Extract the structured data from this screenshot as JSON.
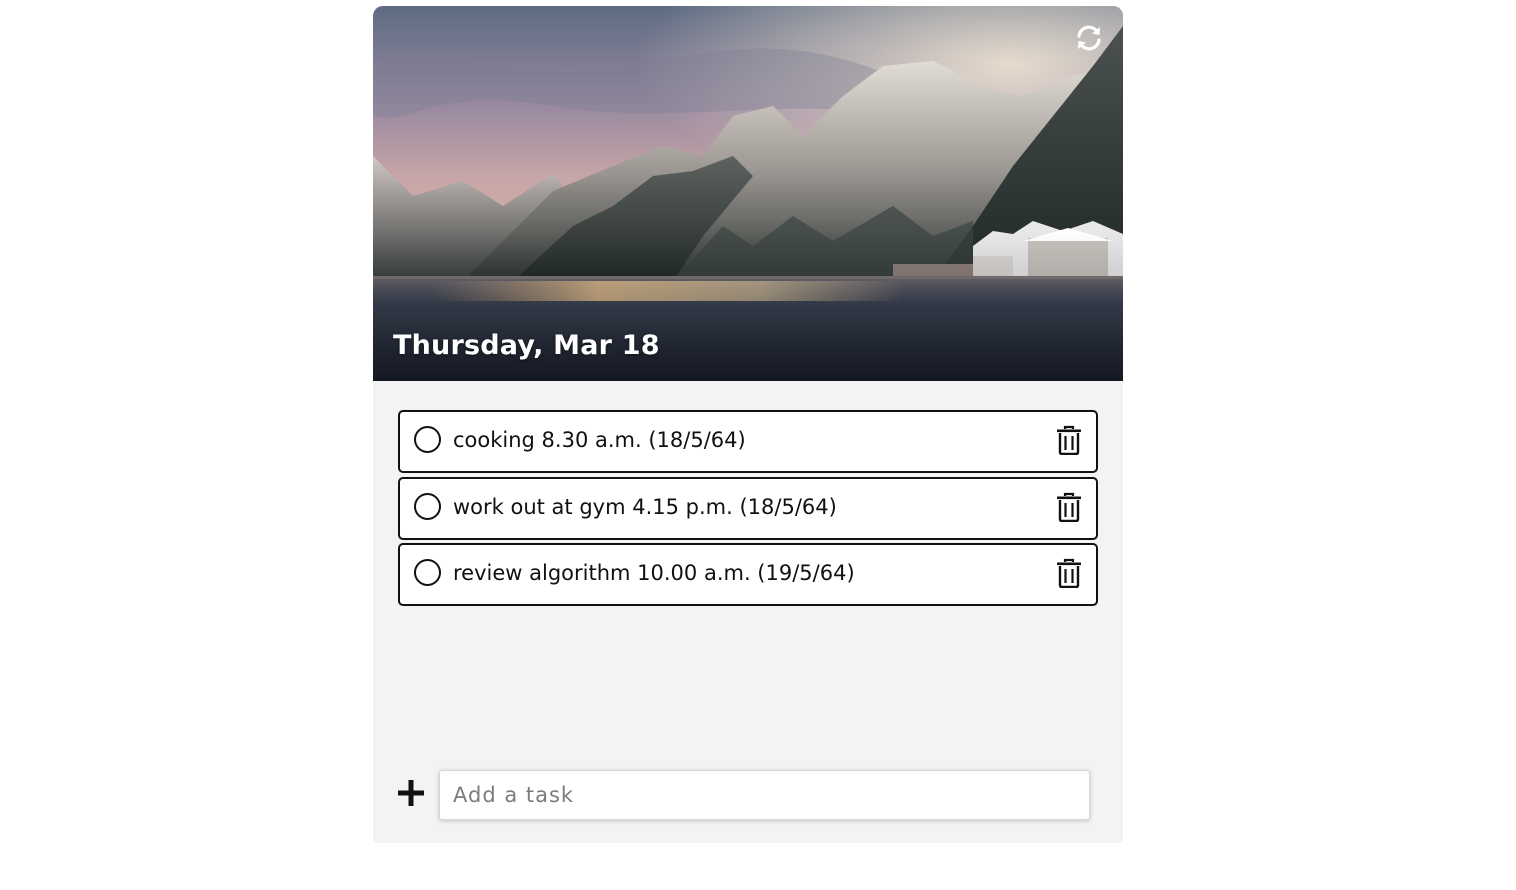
{
  "header": {
    "date_title": "Thursday, Mar 18",
    "refresh_icon": "refresh-icon"
  },
  "tasks": [
    {
      "text": "cooking 8.30 a.m. (18/5/64)",
      "done": false
    },
    {
      "text": "work out at gym 4.15 p.m. (18/5/64)",
      "done": false
    },
    {
      "text": "review algorithm 10.00 a.m. (19/5/64)",
      "done": false
    }
  ],
  "add_task": {
    "placeholder": "Add a task",
    "value": "",
    "icon": "plus-icon"
  },
  "colors": {
    "panel_background": "#f3f3f3",
    "task_border": "#111111",
    "task_background": "#ffffff",
    "title_text": "#ffffff"
  }
}
